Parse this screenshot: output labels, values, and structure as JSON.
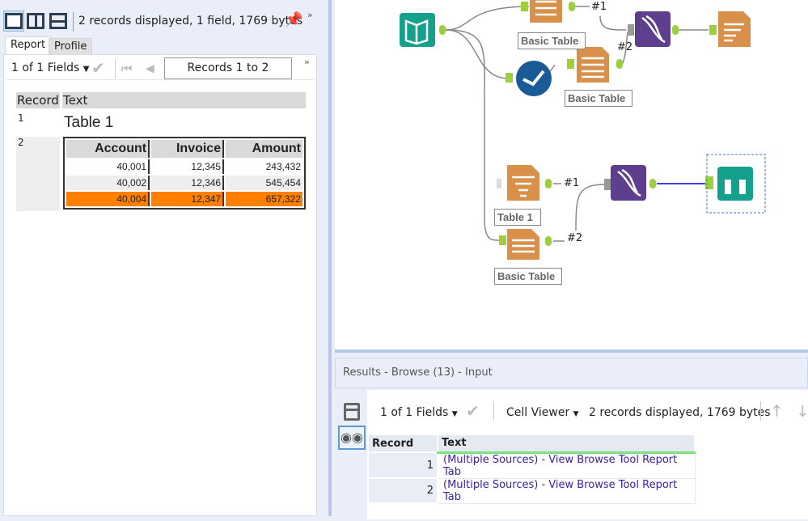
{
  "left_panel": {
    "status": "2 records displayed, 1 field, 1769 bytes",
    "tabs": [
      "Report",
      "Profile"
    ],
    "fields_selector": "1 of 1 Fields",
    "records_range": "Records 1 to 2",
    "grid": {
      "headers": [
        "Record",
        "Text"
      ],
      "rows": [
        {
          "record": "1",
          "text": "Table 1"
        },
        {
          "record": "2",
          "table": {
            "headers": [
              "Account",
              "Invoice",
              "Amount"
            ],
            "rows": [
              [
                "40,001",
                "12,345",
                "243,432"
              ],
              [
                "40,002",
                "12,346",
                "545,454"
              ],
              [
                "40,004",
                "12,347",
                "657,322"
              ]
            ],
            "highlight_color": "#ff8000"
          }
        }
      ]
    }
  },
  "canvas": {
    "labels": [
      "Basic Table",
      "Basic Table",
      "Table 1",
      "Basic Table"
    ],
    "connection_labels": [
      "#1",
      "#2",
      "#1",
      "#2"
    ],
    "colors": {
      "table_tool": "#d9904a",
      "input_tool": "#13a08d",
      "union_tool": "#5d3f8d",
      "select_tool": "#1a5a96",
      "anchor": "#9ccf3d"
    }
  },
  "results": {
    "title": "Results - Browse (13) - Input",
    "fields_selector": "1 of 1 Fields",
    "viewer": "Cell Viewer",
    "status": "2 records displayed, 1769 bytes",
    "headers": [
      "Record",
      "Text"
    ],
    "rows": [
      {
        "record": "1",
        "text": "(Multiple Sources) - View Browse Tool Report Tab"
      },
      {
        "record": "2",
        "text": "(Multiple Sources) - View Browse Tool Report Tab"
      }
    ]
  }
}
